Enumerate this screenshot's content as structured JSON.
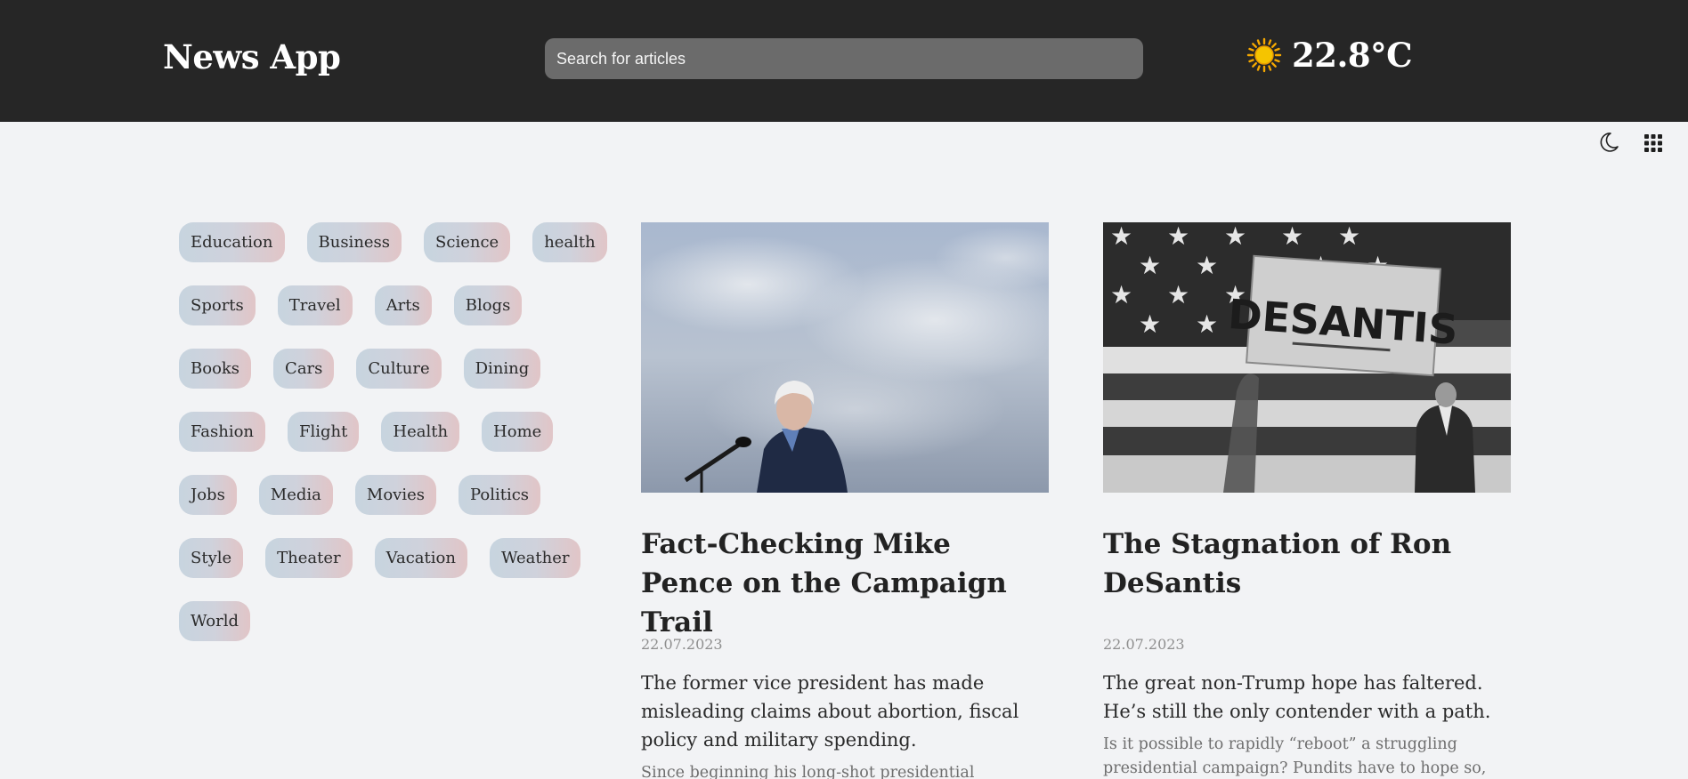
{
  "header": {
    "brand": "News App",
    "search_placeholder": "Search for articles",
    "weather": {
      "icon": "sun-icon",
      "temperature": "22.8°C"
    }
  },
  "toolbar": {
    "theme_icon": "moon-icon",
    "apps_icon": "grid-icon"
  },
  "categories": [
    [
      "Education",
      "Business",
      "Science",
      "health"
    ],
    [
      "Sports",
      "Travel",
      "Arts",
      "Blogs"
    ],
    [
      "Books",
      "Cars",
      "Culture",
      "Dining"
    ],
    [
      "Fashion",
      "Flight",
      "Health",
      "Home"
    ],
    [
      "Jobs",
      "Media",
      "Movies",
      "Politics"
    ],
    [
      "Style",
      "Theater",
      "Vacation",
      "Weather"
    ],
    [
      "World"
    ]
  ],
  "articles": [
    {
      "title": "Fact-Checking Mike Pence on the Campaign Trail",
      "date": "22.07.2023",
      "summary": "The former vice president has made misleading claims about abortion, fiscal policy and military spending.",
      "body": "Since beginning his long-shot presidential"
    },
    {
      "title": "The Stagnation of Ron DeSantis",
      "date": "22.07.2023",
      "summary": "The great non-Trump hope has faltered. He’s still the only contender with a path.",
      "body": "Is it possible to rapidly “reboot” a struggling presidential campaign? Pundits have to hope so,",
      "image_sign_text": "DESANTIS"
    }
  ],
  "colors": {
    "header_bg": "#262626",
    "page_bg": "#f2f3f5",
    "search_bg": "#6b6b6b",
    "sun": "#f5b800"
  }
}
